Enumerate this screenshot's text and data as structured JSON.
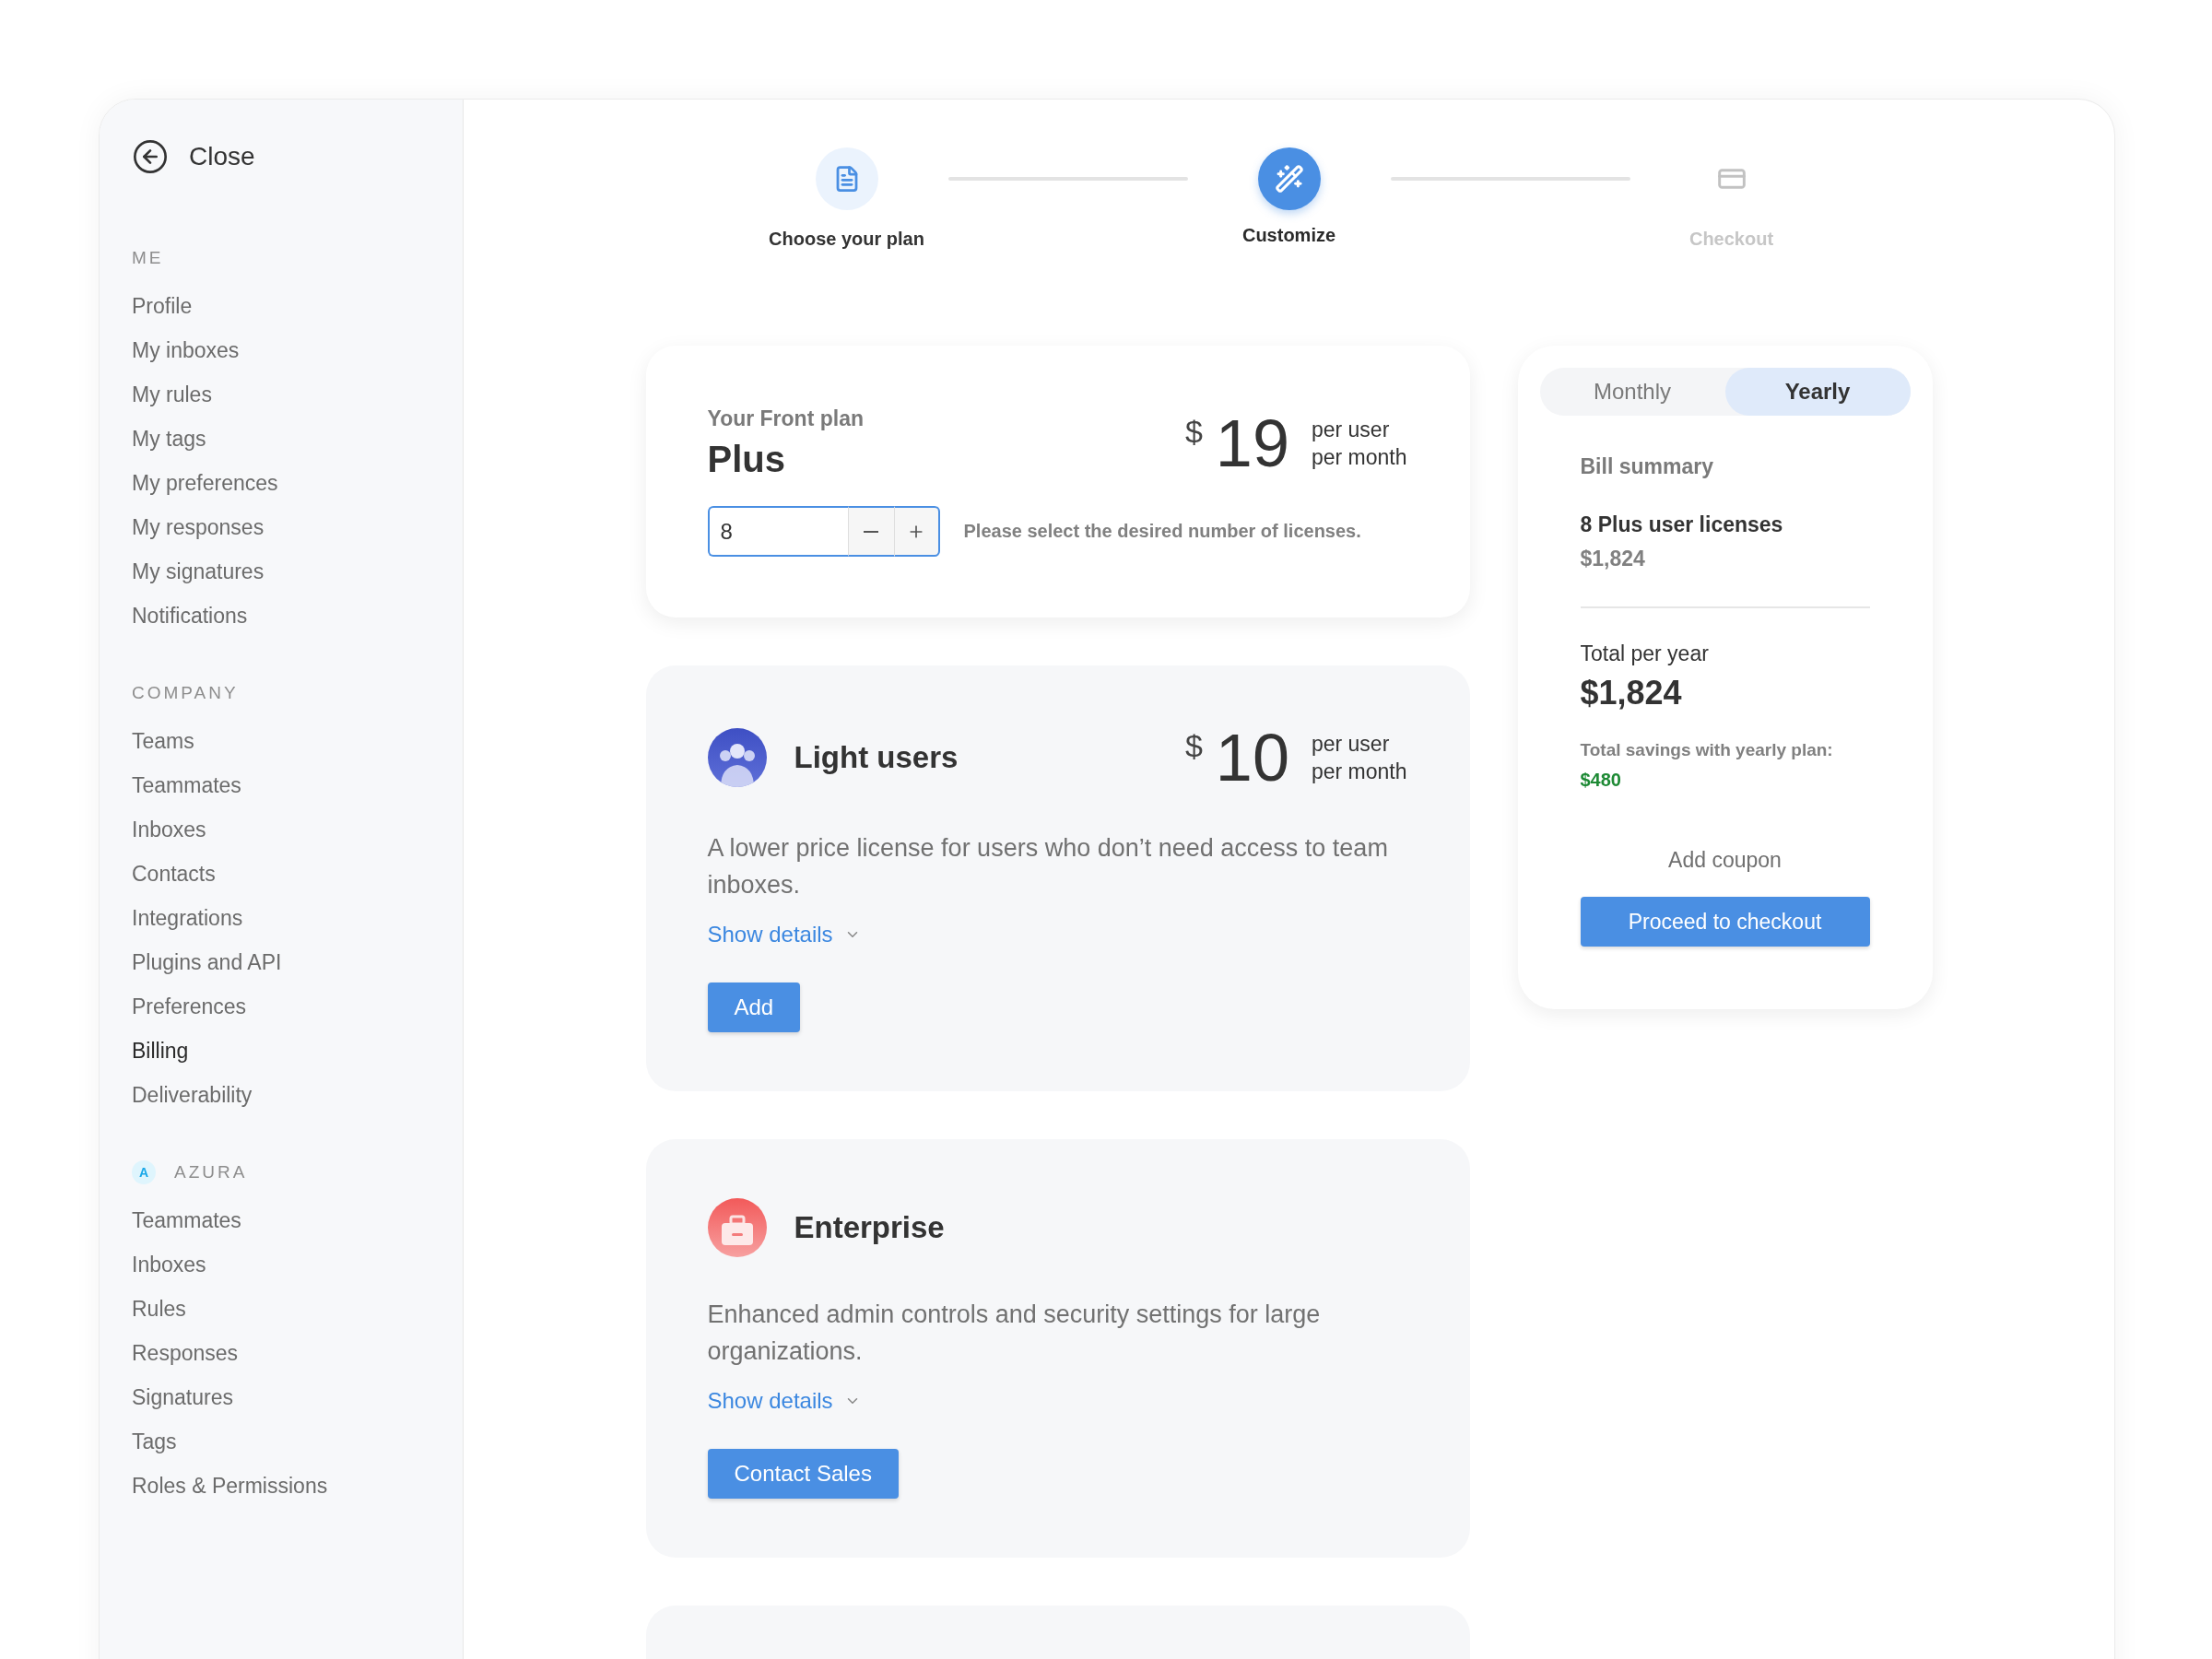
{
  "sidebar": {
    "close_label": "Close",
    "sections": [
      {
        "title": "ME",
        "items": [
          {
            "label": "Profile",
            "selected": false
          },
          {
            "label": "My inboxes",
            "selected": false
          },
          {
            "label": "My rules",
            "selected": false
          },
          {
            "label": "My tags",
            "selected": false
          },
          {
            "label": "My preferences",
            "selected": false
          },
          {
            "label": "My responses",
            "selected": false
          },
          {
            "label": "My signatures",
            "selected": false
          },
          {
            "label": "Notifications",
            "selected": false
          }
        ]
      },
      {
        "title": "COMPANY",
        "items": [
          {
            "label": "Teams",
            "selected": false
          },
          {
            "label": "Teammates",
            "selected": false
          },
          {
            "label": "Inboxes",
            "selected": false
          },
          {
            "label": "Contacts",
            "selected": false
          },
          {
            "label": "Integrations",
            "selected": false
          },
          {
            "label": "Plugins and API",
            "selected": false
          },
          {
            "label": "Preferences",
            "selected": false
          },
          {
            "label": "Billing",
            "selected": true
          },
          {
            "label": "Deliverability",
            "selected": false
          }
        ]
      },
      {
        "title": "AZURA",
        "badge": "A",
        "items": [
          {
            "label": "Teammates",
            "selected": false
          },
          {
            "label": "Inboxes",
            "selected": false
          },
          {
            "label": "Rules",
            "selected": false
          },
          {
            "label": "Responses",
            "selected": false
          },
          {
            "label": "Signatures",
            "selected": false
          },
          {
            "label": "Tags",
            "selected": false
          },
          {
            "label": "Roles & Permissions",
            "selected": false
          }
        ]
      }
    ]
  },
  "stepper": {
    "steps": [
      {
        "kind": "plan",
        "label": "Choose your plan",
        "completed": true,
        "selected": false
      },
      {
        "kind": "customize",
        "label": "Customize",
        "completed": false,
        "selected": true
      },
      {
        "kind": "checkout",
        "label": "Checkout",
        "completed": false,
        "selected": false
      }
    ]
  },
  "plan": {
    "eyebrow": "Your Front plan",
    "name": "Plus",
    "currency": "$",
    "price": "19",
    "unit": [
      "per user",
      "per month"
    ],
    "quantity": "8",
    "hint": "Please select the desired number of licenses."
  },
  "addons": [
    {
      "kind": "light",
      "title": "Light users",
      "currency": "$",
      "price": "10",
      "unit": [
        "per user",
        "per month"
      ],
      "description": "A lower price license for users who don’t need access to team inboxes.",
      "details_link": "Show details",
      "button": "Add"
    },
    {
      "kind": "enterprise",
      "title": "Enterprise",
      "description": "Enhanced admin controls and security settings for large organizations.",
      "details_link": "Show details",
      "button": "Contact Sales"
    }
  ],
  "summary": {
    "billing_tabs": [
      {
        "label": "Monthly",
        "selected": false
      },
      {
        "label": "Yearly",
        "selected": true
      }
    ],
    "title": "Bill summary",
    "line_label": "8 Plus user licenses",
    "line_amount": "$1,824",
    "total_label": "Total per year",
    "total_amount": "$1,824",
    "savings_label": "Total savings with yearly plan:",
    "savings_amount": "$480",
    "coupon": "Add coupon",
    "checkout": "Proceed to checkout"
  }
}
